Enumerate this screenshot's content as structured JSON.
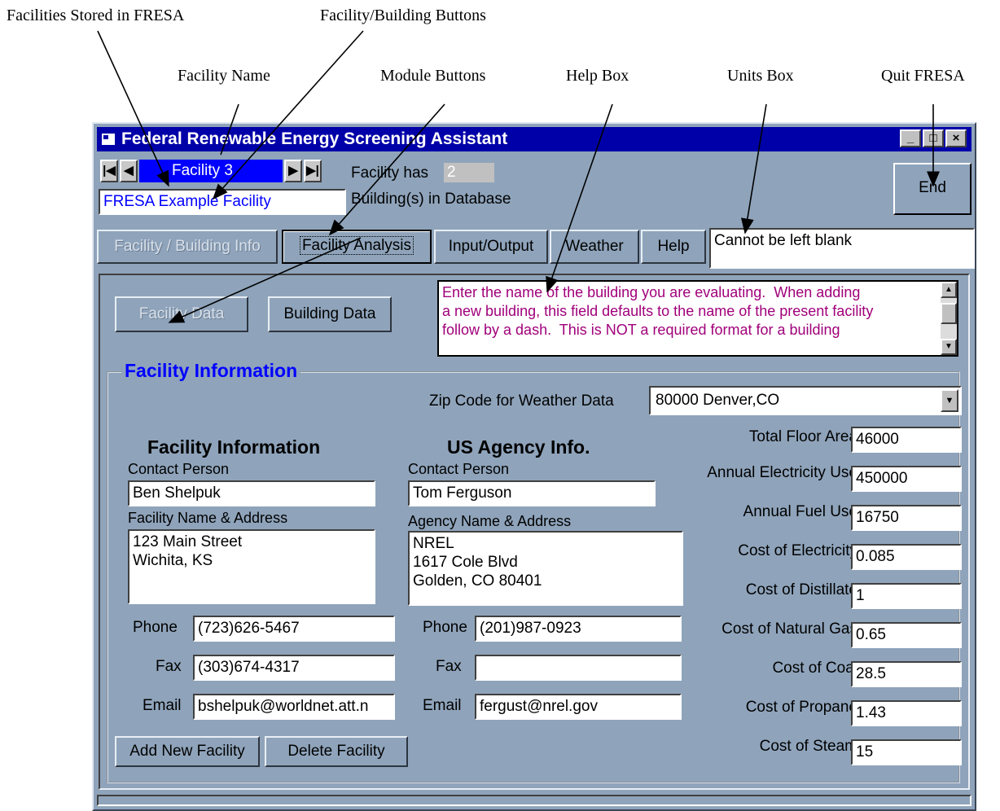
{
  "annotations": {
    "facilities_stored": "Facilities Stored in FRESA",
    "facility_building_buttons": "Facility/Building Buttons",
    "facility_name": "Facility Name",
    "module_buttons": "Module Buttons",
    "help_box": "Help Box",
    "units_box": "Units Box",
    "quit": "Quit FRESA"
  },
  "window": {
    "title": "Federal Renewable Energy Screening Assistant",
    "minimize": "_",
    "maximize": "□",
    "close": "×"
  },
  "nav": {
    "first": "|◀",
    "prev": "◀",
    "record": "Facility 3",
    "next": "▶",
    "last": "▶|",
    "facility_name": "FRESA Example Facility",
    "has_label": "Facility has",
    "building_count": "2",
    "buildings_label": "Building(s) in Database"
  },
  "end_button": "End",
  "tabs": [
    "Facility / Building Info",
    "Facility Analysis",
    "Input/Output",
    "Weather",
    "Help"
  ],
  "units_box": "Cannot be left blank",
  "sub_buttons": {
    "facility_data": "Facility Data",
    "building_data": "Building Data"
  },
  "help_box": "Enter the name of the building you are evaluating.  When adding\na new building, this field defaults to the name of the present facility\nfollow by a dash.  This is NOT a required format for a building",
  "section": {
    "title": "Facility Information",
    "zip_label": "Zip Code for Weather Data",
    "zip_value": "80000 Denver,CO"
  },
  "facility": {
    "heading": "Facility Information",
    "contact_label": "Contact Person",
    "contact": "Ben Shelpuk",
    "address_label": "Facility Name & Address",
    "address": "123 Main Street\nWichita, KS",
    "phone_label": "Phone",
    "phone": "(723)626-5467",
    "fax_label": "Fax",
    "fax": "(303)674-4317",
    "email_label": "Email",
    "email": "bshelpuk@worldnet.att.n"
  },
  "agency": {
    "heading": "US Agency Info.",
    "contact_label": "Contact Person",
    "contact": "Tom Ferguson",
    "address_label": "Agency Name & Address",
    "address": "NREL\n1617 Cole Blvd\nGolden, CO 80401",
    "phone_label": "Phone",
    "phone": "(201)987-0923",
    "fax_label": "Fax",
    "fax": "",
    "email_label": "Email",
    "email": "fergust@nrel.gov"
  },
  "metrics": [
    {
      "label": "Total Floor Area",
      "value": "46000"
    },
    {
      "label": "Annual Electricity Use",
      "value": "450000"
    },
    {
      "label": "Annual Fuel Use",
      "value": "16750"
    },
    {
      "label": "Cost of Electricity",
      "value": "0.085"
    },
    {
      "label": "Cost of Distillate",
      "value": "1"
    },
    {
      "label": "Cost of Natural Gas",
      "value": "0.65"
    },
    {
      "label": "Cost of Coal",
      "value": "28.5"
    },
    {
      "label": "Cost of Propane",
      "value": "1.43"
    },
    {
      "label": "Cost of Steam",
      "value": "15"
    }
  ],
  "actions": {
    "add": "Add New Facility",
    "delete": "Delete Facility"
  }
}
